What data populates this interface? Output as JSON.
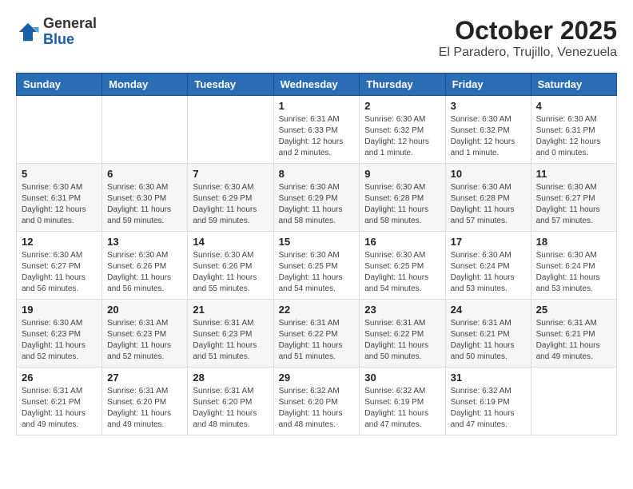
{
  "header": {
    "logo_general": "General",
    "logo_blue": "Blue",
    "month_year": "October 2025",
    "location": "El Paradero, Trujillo, Venezuela"
  },
  "weekdays": [
    "Sunday",
    "Monday",
    "Tuesday",
    "Wednesday",
    "Thursday",
    "Friday",
    "Saturday"
  ],
  "weeks": [
    [
      {
        "day": "",
        "info": ""
      },
      {
        "day": "",
        "info": ""
      },
      {
        "day": "",
        "info": ""
      },
      {
        "day": "1",
        "info": "Sunrise: 6:31 AM\nSunset: 6:33 PM\nDaylight: 12 hours and 2 minutes."
      },
      {
        "day": "2",
        "info": "Sunrise: 6:30 AM\nSunset: 6:32 PM\nDaylight: 12 hours and 1 minute."
      },
      {
        "day": "3",
        "info": "Sunrise: 6:30 AM\nSunset: 6:32 PM\nDaylight: 12 hours and 1 minute."
      },
      {
        "day": "4",
        "info": "Sunrise: 6:30 AM\nSunset: 6:31 PM\nDaylight: 12 hours and 0 minutes."
      }
    ],
    [
      {
        "day": "5",
        "info": "Sunrise: 6:30 AM\nSunset: 6:31 PM\nDaylight: 12 hours and 0 minutes."
      },
      {
        "day": "6",
        "info": "Sunrise: 6:30 AM\nSunset: 6:30 PM\nDaylight: 11 hours and 59 minutes."
      },
      {
        "day": "7",
        "info": "Sunrise: 6:30 AM\nSunset: 6:29 PM\nDaylight: 11 hours and 59 minutes."
      },
      {
        "day": "8",
        "info": "Sunrise: 6:30 AM\nSunset: 6:29 PM\nDaylight: 11 hours and 58 minutes."
      },
      {
        "day": "9",
        "info": "Sunrise: 6:30 AM\nSunset: 6:28 PM\nDaylight: 11 hours and 58 minutes."
      },
      {
        "day": "10",
        "info": "Sunrise: 6:30 AM\nSunset: 6:28 PM\nDaylight: 11 hours and 57 minutes."
      },
      {
        "day": "11",
        "info": "Sunrise: 6:30 AM\nSunset: 6:27 PM\nDaylight: 11 hours and 57 minutes."
      }
    ],
    [
      {
        "day": "12",
        "info": "Sunrise: 6:30 AM\nSunset: 6:27 PM\nDaylight: 11 hours and 56 minutes."
      },
      {
        "day": "13",
        "info": "Sunrise: 6:30 AM\nSunset: 6:26 PM\nDaylight: 11 hours and 56 minutes."
      },
      {
        "day": "14",
        "info": "Sunrise: 6:30 AM\nSunset: 6:26 PM\nDaylight: 11 hours and 55 minutes."
      },
      {
        "day": "15",
        "info": "Sunrise: 6:30 AM\nSunset: 6:25 PM\nDaylight: 11 hours and 54 minutes."
      },
      {
        "day": "16",
        "info": "Sunrise: 6:30 AM\nSunset: 6:25 PM\nDaylight: 11 hours and 54 minutes."
      },
      {
        "day": "17",
        "info": "Sunrise: 6:30 AM\nSunset: 6:24 PM\nDaylight: 11 hours and 53 minutes."
      },
      {
        "day": "18",
        "info": "Sunrise: 6:30 AM\nSunset: 6:24 PM\nDaylight: 11 hours and 53 minutes."
      }
    ],
    [
      {
        "day": "19",
        "info": "Sunrise: 6:30 AM\nSunset: 6:23 PM\nDaylight: 11 hours and 52 minutes."
      },
      {
        "day": "20",
        "info": "Sunrise: 6:31 AM\nSunset: 6:23 PM\nDaylight: 11 hours and 52 minutes."
      },
      {
        "day": "21",
        "info": "Sunrise: 6:31 AM\nSunset: 6:23 PM\nDaylight: 11 hours and 51 minutes."
      },
      {
        "day": "22",
        "info": "Sunrise: 6:31 AM\nSunset: 6:22 PM\nDaylight: 11 hours and 51 minutes."
      },
      {
        "day": "23",
        "info": "Sunrise: 6:31 AM\nSunset: 6:22 PM\nDaylight: 11 hours and 50 minutes."
      },
      {
        "day": "24",
        "info": "Sunrise: 6:31 AM\nSunset: 6:21 PM\nDaylight: 11 hours and 50 minutes."
      },
      {
        "day": "25",
        "info": "Sunrise: 6:31 AM\nSunset: 6:21 PM\nDaylight: 11 hours and 49 minutes."
      }
    ],
    [
      {
        "day": "26",
        "info": "Sunrise: 6:31 AM\nSunset: 6:21 PM\nDaylight: 11 hours and 49 minutes."
      },
      {
        "day": "27",
        "info": "Sunrise: 6:31 AM\nSunset: 6:20 PM\nDaylight: 11 hours and 49 minutes."
      },
      {
        "day": "28",
        "info": "Sunrise: 6:31 AM\nSunset: 6:20 PM\nDaylight: 11 hours and 48 minutes."
      },
      {
        "day": "29",
        "info": "Sunrise: 6:32 AM\nSunset: 6:20 PM\nDaylight: 11 hours and 48 minutes."
      },
      {
        "day": "30",
        "info": "Sunrise: 6:32 AM\nSunset: 6:19 PM\nDaylight: 11 hours and 47 minutes."
      },
      {
        "day": "31",
        "info": "Sunrise: 6:32 AM\nSunset: 6:19 PM\nDaylight: 11 hours and 47 minutes."
      },
      {
        "day": "",
        "info": ""
      }
    ]
  ]
}
